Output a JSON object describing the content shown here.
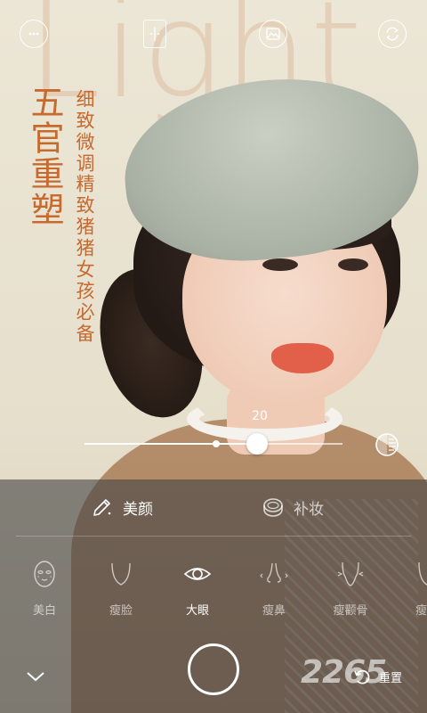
{
  "photo": {
    "background_word": "Light"
  },
  "top_bar": {
    "icons": [
      "menu-dots-icon",
      "compare-frame-icon",
      "gallery-icon",
      "switch-camera-icon"
    ]
  },
  "promo": {
    "headline": "五官重塑",
    "line1": "细致微调",
    "line2": "精致猪猪女孩必备"
  },
  "slider": {
    "value": "20",
    "fraction": 0.67
  },
  "tabs": [
    {
      "label": "美颜",
      "active": true,
      "icon": "beauty-pen-icon"
    },
    {
      "label": "补妆",
      "active": false,
      "icon": "compact-icon"
    }
  ],
  "features": [
    {
      "label": "美白",
      "icon": "face-mask-icon",
      "active": false
    },
    {
      "label": "瘦脸",
      "icon": "slim-face-icon",
      "active": false
    },
    {
      "label": "大眼",
      "icon": "eye-icon",
      "active": true
    },
    {
      "label": "瘦鼻",
      "icon": "nose-icon",
      "active": false
    },
    {
      "label": "瘦颧骨",
      "icon": "cheekbone-icon",
      "active": false
    },
    {
      "label": "瘦下",
      "icon": "chin-icon",
      "active": false
    }
  ],
  "bottom": {
    "reset_label": "重置",
    "site_mark": "2265"
  },
  "colors": {
    "accent": "#c76a2f",
    "panel": "#464646"
  }
}
